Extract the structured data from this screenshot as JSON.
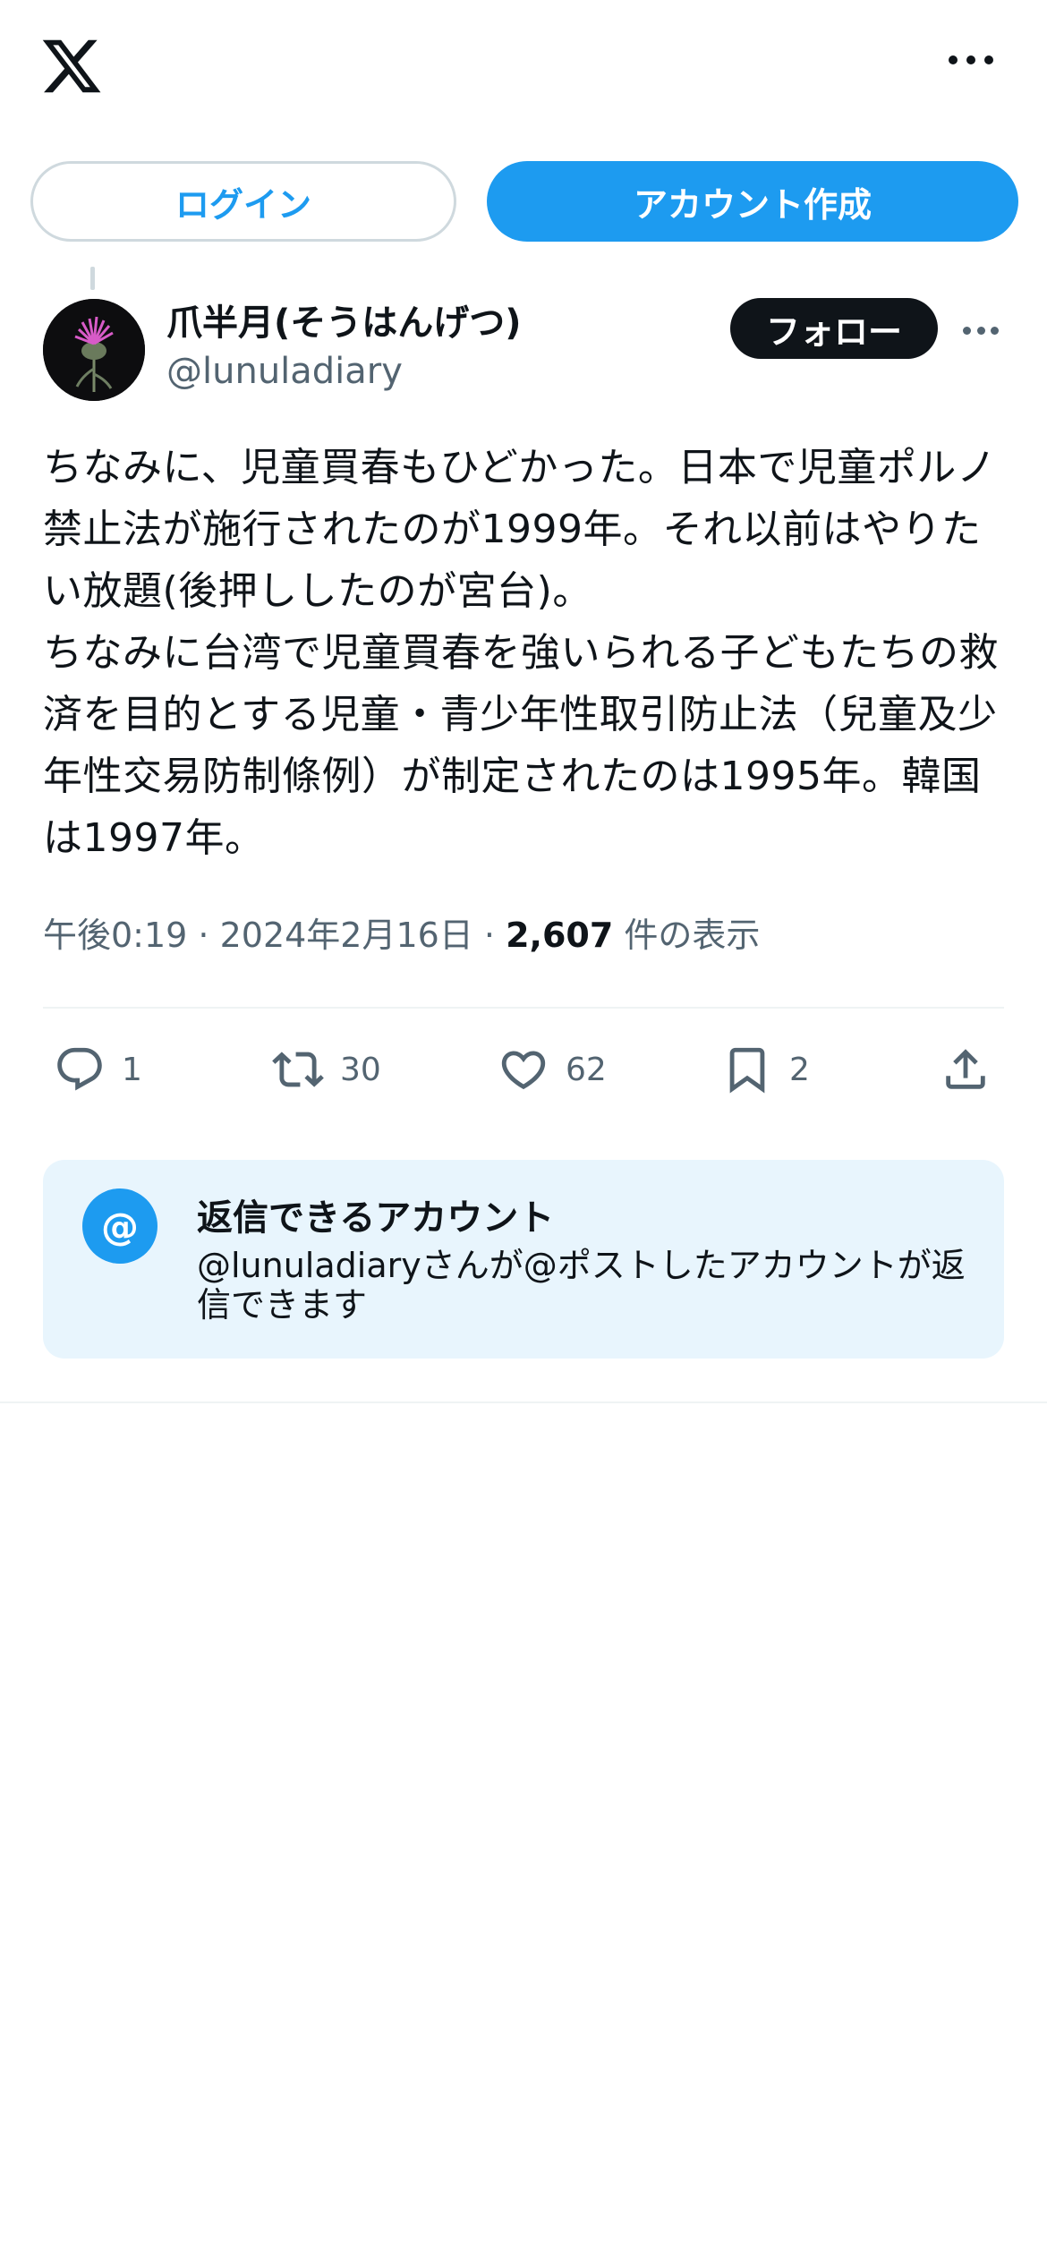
{
  "header": {
    "logo_icon": "x-logo-icon",
    "more_icon": "more-dots-icon"
  },
  "auth": {
    "login_label": "ログイン",
    "signup_label": "アカウント作成"
  },
  "author": {
    "name": "爪半月(そうはんげつ)",
    "handle": "@lunuladiary",
    "follow_label": "フォロー"
  },
  "post": {
    "text": "ちなみに、児童買春もひどかった。日本で児童ポルノ禁止法が施行されたのが1999年。それ以前はやりたい放題(後押ししたのが宮台)。\nちなみに台湾で児童買春を強いられる子どもたちの救済を目的とする児童・青少年性取引防止法（兒童及少年性交易防制條例）が制定されたのは1995年。韓国は1997年。",
    "time": "午後0:19",
    "date": "2024年2月16日",
    "views": "2,607",
    "views_label": "件の表示"
  },
  "actions": {
    "replies": "1",
    "reposts": "30",
    "likes": "62",
    "bookmarks": "2"
  },
  "reply_notice": {
    "title": "返信できるアカウント",
    "text": "@lunuladiaryさんが@ポストしたアカウントが返信できます",
    "icon": "@"
  },
  "colors": {
    "accent": "#1d9bf0",
    "text": "#0f1419",
    "muted": "#536471",
    "notice_bg": "#e8f5fd"
  }
}
